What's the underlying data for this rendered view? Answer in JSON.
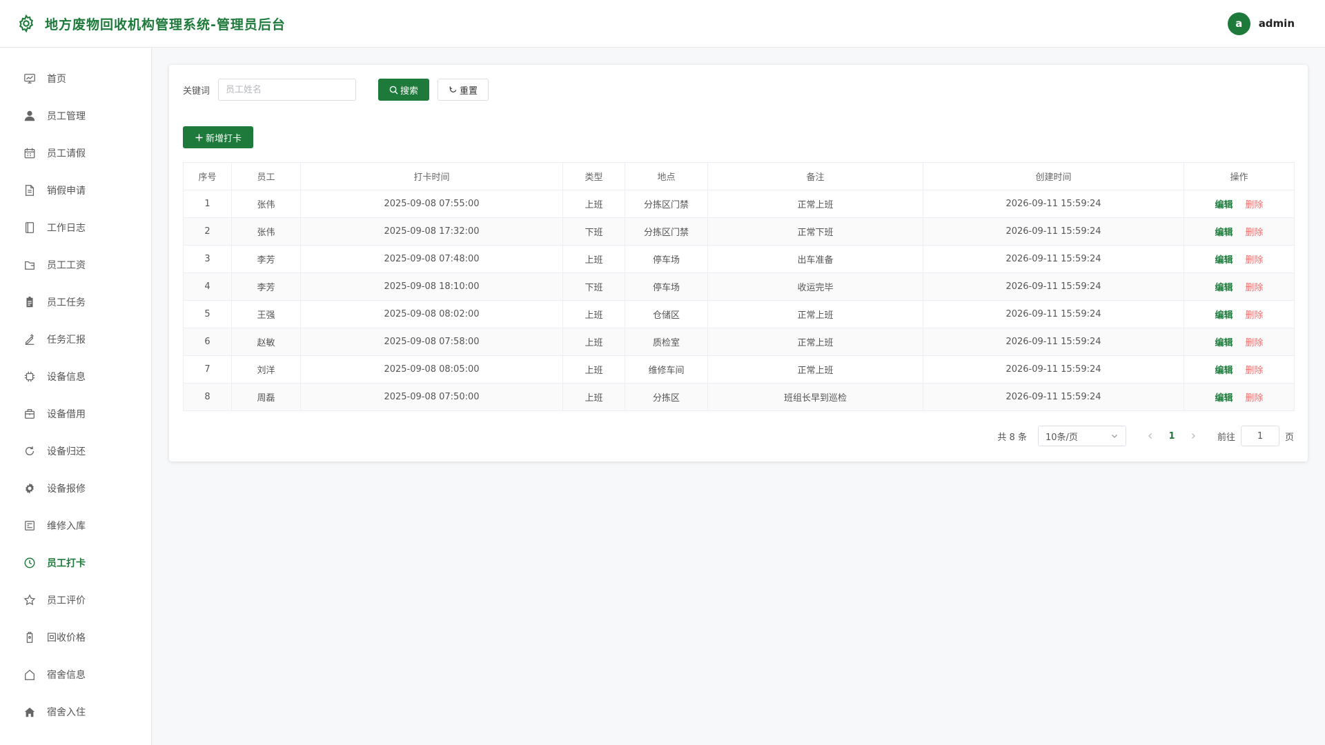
{
  "header": {
    "title": "地方废物回收机构管理系统-管理员后台",
    "avatar_letter": "a",
    "username": "admin",
    "brand_color": "#1d7a3a"
  },
  "sidebar": {
    "items": [
      {
        "label": "首页",
        "icon": "dashboard-icon"
      },
      {
        "label": "员工管理",
        "icon": "user-icon"
      },
      {
        "label": "员工请假",
        "icon": "calendar-icon"
      },
      {
        "label": "销假申请",
        "icon": "document-icon"
      },
      {
        "label": "工作日志",
        "icon": "notebook-icon"
      },
      {
        "label": "员工工资",
        "icon": "wallet-icon"
      },
      {
        "label": "员工任务",
        "icon": "clipboard-icon"
      },
      {
        "label": "任务汇报",
        "icon": "edit-icon"
      },
      {
        "label": "设备信息",
        "icon": "cpu-icon"
      },
      {
        "label": "设备借用",
        "icon": "briefcase-icon"
      },
      {
        "label": "设备归还",
        "icon": "refresh-icon"
      },
      {
        "label": "设备报修",
        "icon": "gear-icon"
      },
      {
        "label": "维修入库",
        "icon": "box-icon"
      },
      {
        "label": "员工打卡",
        "icon": "clock-icon",
        "active": true
      },
      {
        "label": "员工评价",
        "icon": "star-icon"
      },
      {
        "label": "回收价格",
        "icon": "price-tag-icon"
      },
      {
        "label": "宿舍信息",
        "icon": "house-outline-icon"
      },
      {
        "label": "宿舍入住",
        "icon": "house-filled-icon"
      }
    ]
  },
  "search": {
    "label": "关键词",
    "placeholder": "员工姓名",
    "value": "",
    "search_label": "搜索",
    "reset_label": "重置"
  },
  "toolbar": {
    "add_label": "新增打卡"
  },
  "table": {
    "columns": [
      "序号",
      "员工",
      "打卡时间",
      "类型",
      "地点",
      "备注",
      "创建时间",
      "操作"
    ],
    "edit_label": "编辑",
    "delete_label": "删除",
    "rows": [
      {
        "no": "1",
        "employee": "张伟",
        "time": "2025-09-08 07:55:00",
        "type": "上班",
        "place": "分拣区门禁",
        "note": "正常上班",
        "created": "2026-09-11 15:59:24"
      },
      {
        "no": "2",
        "employee": "张伟",
        "time": "2025-09-08 17:32:00",
        "type": "下班",
        "place": "分拣区门禁",
        "note": "正常下班",
        "created": "2026-09-11 15:59:24"
      },
      {
        "no": "3",
        "employee": "李芳",
        "time": "2025-09-08 07:48:00",
        "type": "上班",
        "place": "停车场",
        "note": "出车准备",
        "created": "2026-09-11 15:59:24"
      },
      {
        "no": "4",
        "employee": "李芳",
        "time": "2025-09-08 18:10:00",
        "type": "下班",
        "place": "停车场",
        "note": "收运完毕",
        "created": "2026-09-11 15:59:24"
      },
      {
        "no": "5",
        "employee": "王强",
        "time": "2025-09-08 08:02:00",
        "type": "上班",
        "place": "仓储区",
        "note": "正常上班",
        "created": "2026-09-11 15:59:24"
      },
      {
        "no": "6",
        "employee": "赵敏",
        "time": "2025-09-08 07:58:00",
        "type": "上班",
        "place": "质检室",
        "note": "正常上班",
        "created": "2026-09-11 15:59:24"
      },
      {
        "no": "7",
        "employee": "刘洋",
        "time": "2025-09-08 08:05:00",
        "type": "上班",
        "place": "维修车间",
        "note": "正常上班",
        "created": "2026-09-11 15:59:24"
      },
      {
        "no": "8",
        "employee": "周磊",
        "time": "2025-09-08 07:50:00",
        "type": "上班",
        "place": "分拣区",
        "note": "班组长早到巡检",
        "created": "2026-09-11 15:59:24"
      }
    ]
  },
  "pagination": {
    "total_text": "共 8 条",
    "page_size": "10条/页",
    "current_page": "1",
    "goto_label": "前往",
    "goto_value": "1",
    "goto_suffix": "页"
  }
}
